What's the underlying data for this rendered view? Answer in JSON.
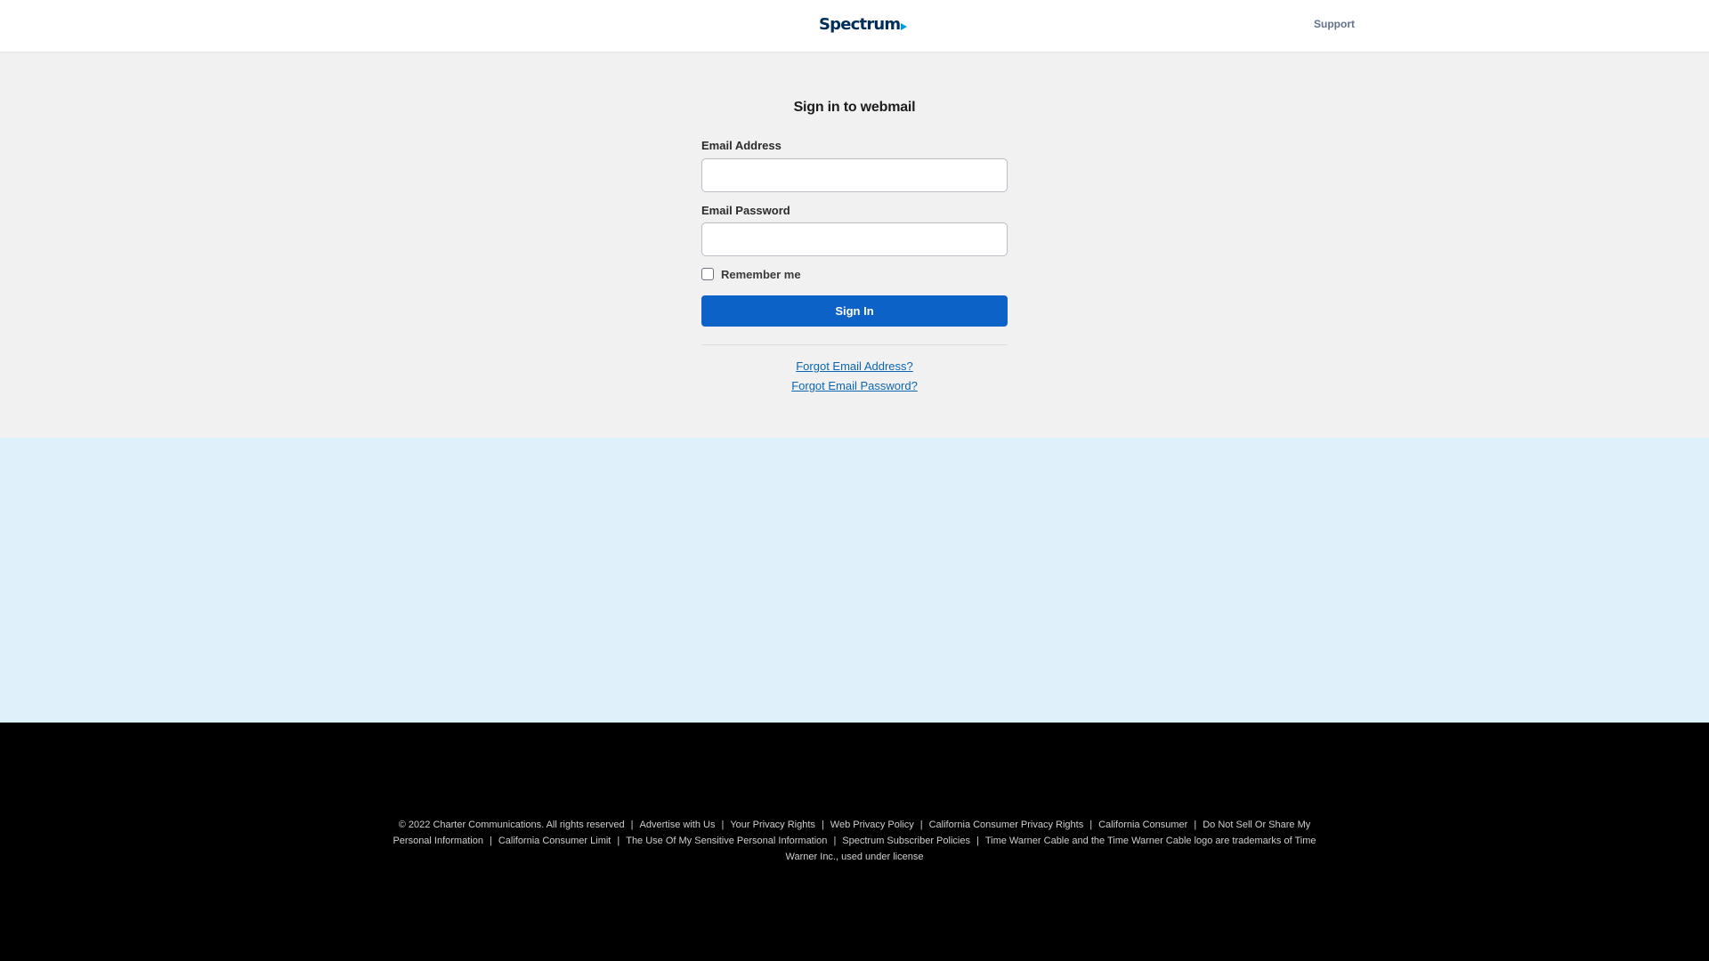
{
  "header": {
    "logo_text": "Spectrum",
    "support_label": "Support"
  },
  "login": {
    "title": "Sign in to webmail",
    "email_label": "Email Address",
    "email_value": "",
    "password_label": "Email Password",
    "password_value": "",
    "remember_label": "Remember me",
    "remember_checked": false,
    "signin_label": "Sign In",
    "forgot_email": "Forgot Email Address?",
    "forgot_password": "Forgot Email Password?"
  },
  "footer": {
    "copyright": "© 2022 Charter Communications. All rights reserved",
    "links": [
      "Advertise with Us",
      "Your Privacy Rights",
      "Web Privacy Policy",
      "California Consumer Privacy Rights",
      "California Consumer",
      "Do Not Sell Or Share My Personal Information",
      "California Consumer Limit",
      "The Use Of My Sensitive Personal Information",
      "Spectrum Subscriber Policies"
    ],
    "trademark": "Time Warner Cable and the Time Warner Cable logo are trademarks of Time Warner Inc., used under license"
  },
  "colors": {
    "primary_button": "#0d62c7",
    "link": "#0b66b2",
    "main_bg": "#f1f1f1",
    "promo_bg": "#e0f0fb",
    "footer_bg": "#000000"
  }
}
